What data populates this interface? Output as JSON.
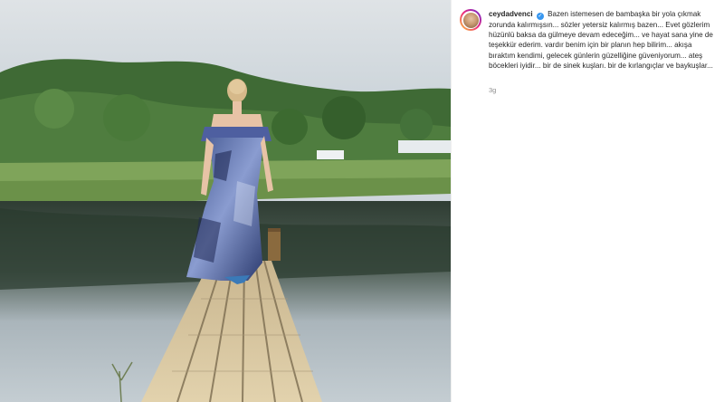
{
  "post": {
    "username": "ceydadvenci",
    "verified_icon": "verified-badge-icon",
    "caption_text": "Bazen istemesen de bambaşka bir yola çıkmak zorunda kalırmışsın... sözler yetersiz kalırmış bazen... Evet gözlerim hüzünlü baksa da gülmeye devam edeceğim... ve hayat sana yine de teşekkür ederim. vardır benim için bir planın hep bilirim... akışa bıraktım kendimi, gelecek günlerin güzelliğine güveniyorum... ateş böcekleri iyidir... bir de sinek kuşları. bir de kırlangıçlar ve baykuşlar...",
    "timestamp": "3g"
  },
  "colors": {
    "verified": "#3897f0",
    "text": "#262626",
    "muted": "#8e8e8e"
  }
}
